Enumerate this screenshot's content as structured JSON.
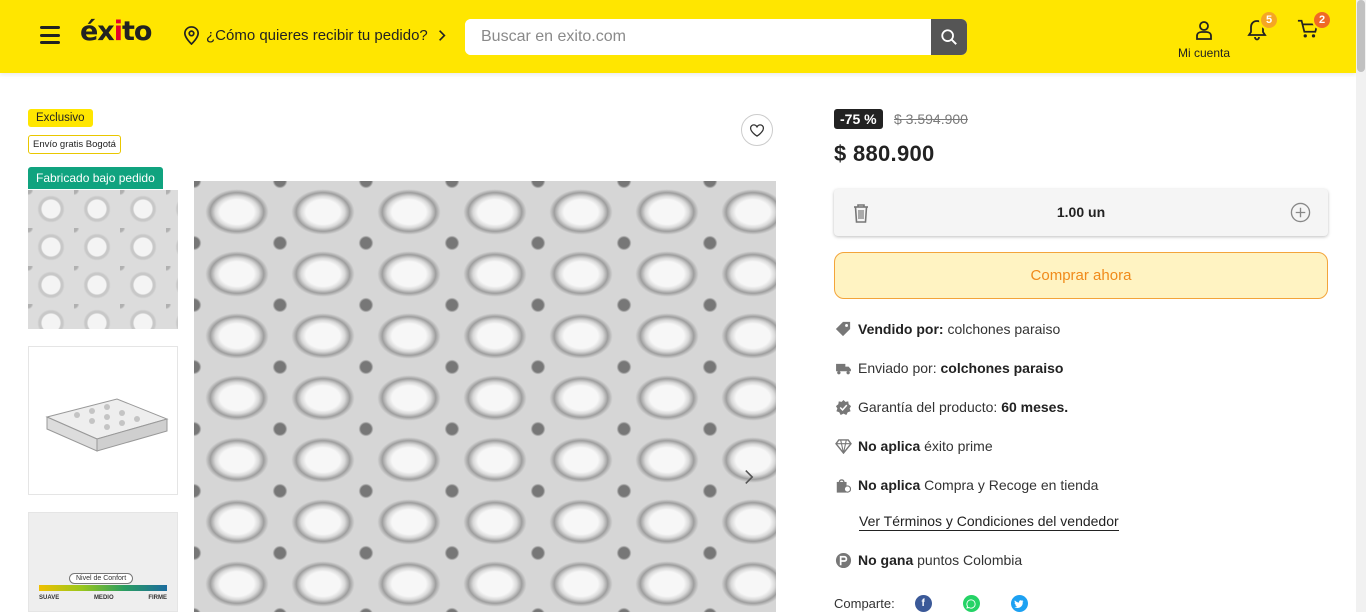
{
  "header": {
    "logo": "éxito",
    "delivery_prompt": "¿Cómo quieres recibir tu pedido?",
    "search_placeholder": "Buscar en exito.com",
    "account_label": "Mi cuenta",
    "notifications_count": "5",
    "cart_count": "2",
    "brand_color": "#ffe600"
  },
  "tags": {
    "exclusivo": "Exclusivo",
    "envio": "Envío gratis Bogotá",
    "fabricado": "Fabricado bajo pedido"
  },
  "gallery": {
    "comfort_label": "Nivel de Confort",
    "comfort_scale": [
      "SUAVE",
      "MEDIO",
      "FIRME"
    ]
  },
  "product": {
    "discount": "-75 %",
    "old_price": "$ 3.594.900",
    "price": "$ 880.900",
    "quantity": "1.00 un",
    "buy_label": "Comprar ahora"
  },
  "details": {
    "sold_by_label": "Vendido por:",
    "sold_by_value": "colchones paraiso",
    "shipped_by_label": "Enviado por:",
    "shipped_by_value": "colchones paraiso",
    "warranty_label": "Garantía del producto:",
    "warranty_value": "60 meses.",
    "prime_label": "No aplica",
    "prime_value": "éxito prime",
    "pickup_label": "No aplica",
    "pickup_value": "Compra y Recoge en tienda",
    "terms_link": "Ver Términos y Condiciones del vendedor",
    "points_label": "No gana",
    "points_value": "puntos Colombia"
  },
  "share": {
    "label": "Comparte:"
  }
}
